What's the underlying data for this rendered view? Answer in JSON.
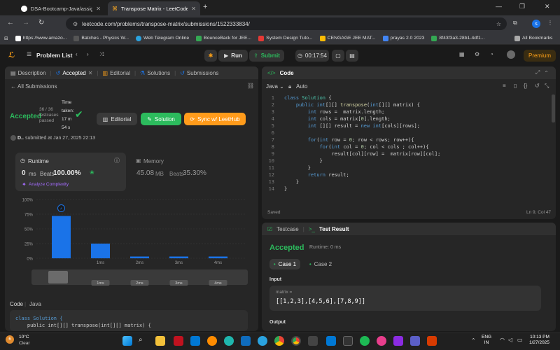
{
  "browser": {
    "tabs": [
      {
        "title": "DSA-Bootcamp-Java/assignme",
        "active": false
      },
      {
        "title": "Transpose Matrix - LeetCode",
        "active": true
      }
    ],
    "url": "leetcode.com/problems/transpose-matrix/submissions/1522333834/",
    "bookmarks": [
      "https://www.amazo...",
      "Batches - Physics W...",
      "Web Telegram Online",
      "BounceBack for JEE...",
      "System Design Tuto...",
      "CENGAGE JEE MAT...",
      "prayas 2.0 2023",
      "8f43f3a3-28b1-4df1..."
    ],
    "all_bookmarks": "All Bookmarks",
    "profile_letter": "s"
  },
  "nav": {
    "problem_list": "Problem List",
    "run": "Run",
    "submit": "Submit",
    "timer": "00:17:54",
    "premium": "Premium"
  },
  "left": {
    "tabs": [
      "Description",
      "Accepted",
      "Editorial",
      "Solutions",
      "Submissions"
    ],
    "all_submissions": "All Submissions",
    "status": "Accepted",
    "testcases": "36 / 36",
    "testcases_label": "testcases",
    "passed": "passed",
    "time_label": "Time",
    "time_taken_label": "taken:",
    "time_taken_min": "17 m",
    "time_taken_sec": "54 s",
    "editorial_btn": "Editorial",
    "solution_btn": "Solution",
    "sync_btn": "Sync w/ LeetHub",
    "user": "D..",
    "submitted_at": "submitted at Jan 27, 2025 22:13",
    "runtime_label": "Runtime",
    "runtime_value": "0",
    "runtime_unit": "ms",
    "beats_label": "Beats",
    "runtime_beats": "100.00%",
    "analyze": "Analyze Complexity",
    "memory_label": "Memory",
    "memory_value": "45.08",
    "memory_unit": "MB",
    "memory_beats": "35.30%",
    "code_label": "Code",
    "lang": "Java",
    "code_preview": [
      "class Solution {",
      "    public int[][] transpose(int[][] matrix) {"
    ]
  },
  "chart_data": {
    "type": "bar",
    "y_ticks": [
      "100%",
      "75%",
      "50%",
      "25%",
      "0%"
    ],
    "categories": [
      "",
      "1ms",
      "2ms",
      "3ms",
      "4ms"
    ],
    "values": [
      72,
      25,
      3,
      3,
      3
    ],
    "ylim": [
      0,
      100
    ],
    "minimap_labels": [
      "1ms",
      "2ms",
      "3ms",
      "4ms"
    ],
    "color": "#1a73e8"
  },
  "editor": {
    "title": "Code",
    "lang": "Java",
    "auto": "Auto",
    "saved": "Saved",
    "cursor": "Ln 9, Col 47",
    "lines": [
      "class Solution {",
      "    public int[][] transpose(int[][] matrix) {",
      "        int rows =  matrix.length;",
      "        int cols = matrix[0].length;",
      "        int [][] result = new int[cols][rows];",
      "",
      "        for(int row = 0; row < rows; row++){",
      "            for(int col = 0; col < cols ; col++){",
      "                result[col][row] =  matrix[row][col];",
      "            }",
      "        }",
      "        return result;",
      "    }",
      "}"
    ]
  },
  "result": {
    "testcase_tab": "Testcase",
    "result_tab": "Test Result",
    "status": "Accepted",
    "runtime": "Runtime: 0 ms",
    "case1": "Case 1",
    "case2": "Case 2",
    "input_label": "Input",
    "var_label": "matrix =",
    "input_value": "[[1,2,3],[4,5,6],[7,8,9]]",
    "output_label": "Output"
  },
  "taskbar": {
    "temp": "10°C",
    "weather": "Clear",
    "badge": "6",
    "lang1": "ENG",
    "lang2": "IN",
    "time": "10:13 PM",
    "date": "1/27/2025"
  }
}
